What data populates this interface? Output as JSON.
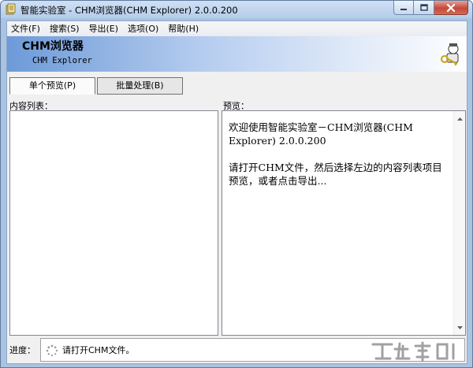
{
  "window": {
    "title": "智能实验室 - CHM浏览器(CHM Explorer) 2.0.0.200"
  },
  "menu": [
    {
      "label": "文件(F)"
    },
    {
      "label": "搜索(S)"
    },
    {
      "label": "导出(E)"
    },
    {
      "label": "选项(O)"
    },
    {
      "label": "帮助(H)"
    }
  ],
  "banner": {
    "title": "CHM浏览器",
    "subtitle": "CHM Explorer",
    "icon": "key-wizard-icon"
  },
  "tabs": [
    {
      "label": "单个预览(P)",
      "active": true
    },
    {
      "label": "批量处理(B)",
      "active": false
    }
  ],
  "content_list": {
    "label": "内容列表："
  },
  "preview": {
    "label": "预览：",
    "line1": "欢迎使用智能实验室－CHM浏览器(CHM Explorer) 2.0.0.200",
    "line2": "请打开CHM文件，然后选择左边的内容列表项目预览，或者点击导出..."
  },
  "progress": {
    "label": "进度：",
    "status": "请打开CHM文件。",
    "icon": "spinner-icon"
  },
  "watermark": {
    "icon": "watermark-logo"
  },
  "colors": {
    "title_bar": "#b5cdea",
    "banner_start": "#6d9ad8",
    "close_button": "#c6483a",
    "client_bg": "#f0f0f0"
  }
}
